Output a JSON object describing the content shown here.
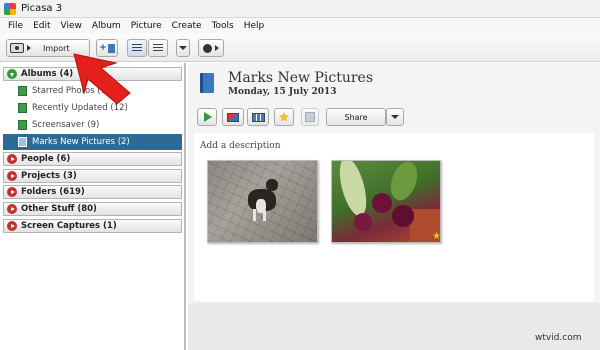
{
  "window": {
    "title": "Picasa 3",
    "icon": "picasa-logo-icon"
  },
  "menu": [
    "File",
    "Edit",
    "View",
    "Album",
    "Picture",
    "Create",
    "Tools",
    "Help"
  ],
  "toolbar": {
    "import_label": "Import",
    "icons": [
      "camera-icon",
      "add-album-icon",
      "list-view-icon",
      "tree-view-icon",
      "view-menu-icon",
      "people-icon"
    ]
  },
  "sidebar": {
    "albums_section": "Albums (4)",
    "albums": [
      {
        "label": "Starred Photos (1)",
        "icon": "star-album-icon"
      },
      {
        "label": "Recently Updated (12)",
        "icon": "album-icon"
      },
      {
        "label": "Screensaver (9)",
        "icon": "album-icon"
      },
      {
        "label": "Marks New Pictures (2)",
        "icon": "album-icon",
        "selected": true
      }
    ],
    "sections": [
      "People (6)",
      "Projects (3)",
      "Folders (619)",
      "Other Stuff (80)",
      "Screen Captures (1)"
    ]
  },
  "main": {
    "album_title": "Marks New Pictures",
    "album_date": "Monday, 15 July 2013",
    "share_label": "Share",
    "description_placeholder": "Add a description",
    "photos": [
      {
        "name": "dog-photo",
        "starred": false
      },
      {
        "name": "beetroot-photo",
        "starred": true
      }
    ],
    "accent_color": "#2d6b96"
  },
  "annotation": {
    "arrow_color": "#e3201b",
    "points_to": "import-button"
  },
  "watermark": "wtvid.com"
}
